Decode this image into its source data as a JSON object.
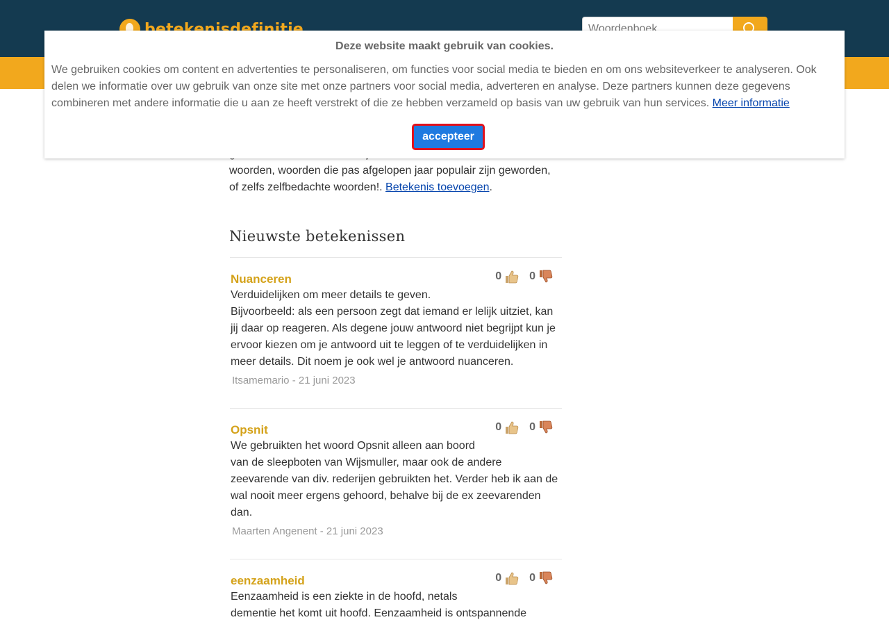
{
  "header": {
    "logo_text": "betekenisdefinitie",
    "search_placeholder": "Woordenboek",
    "search_button_icon": "search-icon"
  },
  "intro": {
    "text": "gaan om voornamen, moeilijke woorden, straattaal, buitenlandse woorden, woorden die pas afgelopen jaar populair zijn geworden, of zelfs zelfbedachte woorden!. ",
    "link_label": "Betekenis toevoegen",
    "suffix": "."
  },
  "section_title": "Nieuwste betekenissen",
  "entries": [
    {
      "word": "Nuanceren",
      "upvotes": "0",
      "downvotes": "0",
      "text": "Verduidelijken om meer details te geven.\nBijvoorbeeld: als een persoon zegt dat iemand er lelijk uitziet, kan jij daar op reageren. Als degene jouw antwoord niet begrijpt kun je ervoor kiezen om je antwoord uit te leggen of te verduidelijken in meer details. Dit noem je ook wel je antwoord nuanceren.",
      "meta": "Itsamemario - 21 juni 2023"
    },
    {
      "word": "Opsnit",
      "upvotes": "0",
      "downvotes": "0",
      "text": "We gebruikten het woord Opsnit alleen aan boord\nvan de sleepboten van Wijsmuller, maar ook de andere zeevarende van div. rederijen gebruikten het. Verder heb ik aan de wal nooit meer ergens gehoord, behalve bij de ex zeevarenden dan.",
      "meta": "Maarten Angenent - 21 juni 2023"
    },
    {
      "word": "eenzaamheid",
      "upvotes": "0",
      "downvotes": "0",
      "text": "Eenzaamheid is een ziekte in de hoofd, netals\ndementie het komt uit hoofd. Eenzaamheid is ontspannende",
      "meta": ""
    }
  ],
  "cookie": {
    "title": "Deze website maakt gebruik van cookies.",
    "text": "We gebruiken cookies om content en advertenties te personaliseren, om functies voor social media te bieden en om ons websiteverkeer te analyseren. Ook delen we informatie over uw gebruik van onze site met onze partners voor social media, adverteren en analyse. Deze partners kunnen deze gegevens combineren met andere informatie die u aan ze heeft verstrekt of die ze hebben verzameld op basis van uw gebruik van hun services. ",
    "more_info_label": "Meer informatie",
    "accept_label": "accepteer"
  },
  "colors": {
    "header_bg": "#143a50",
    "accent": "#f2a81d",
    "word_link": "#d4a21a",
    "accept_button": "#1f7ae0",
    "accept_border": "#e0121d"
  }
}
